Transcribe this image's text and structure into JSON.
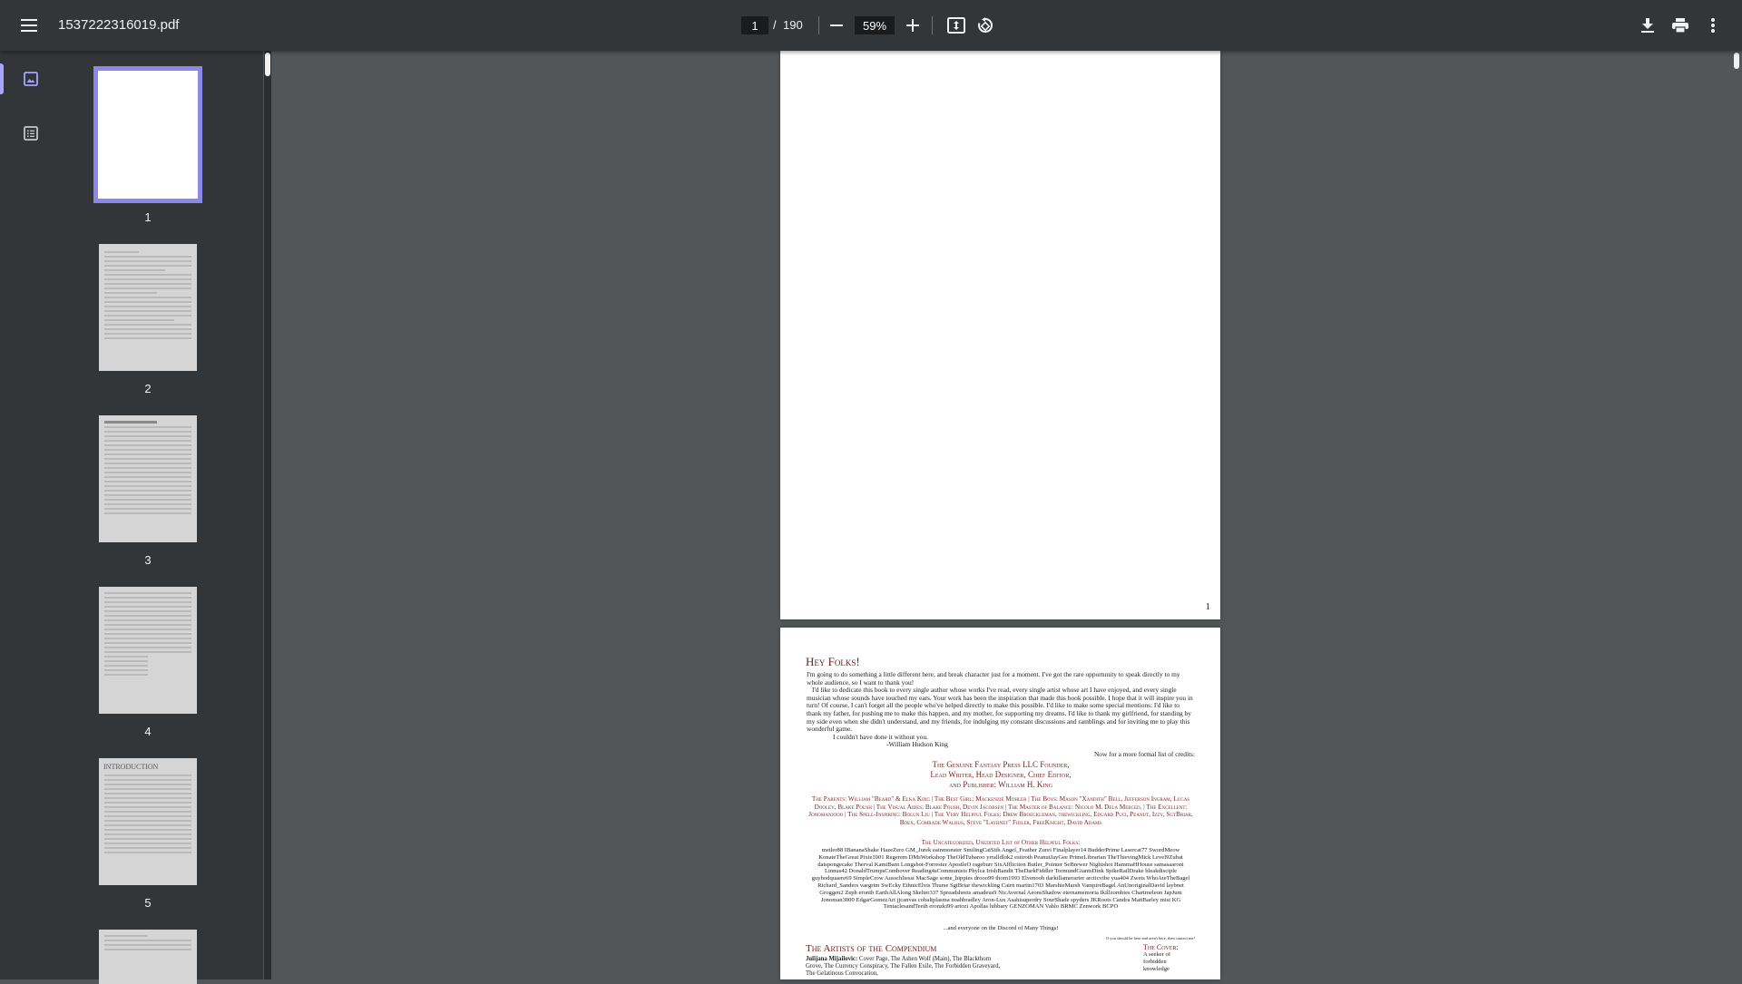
{
  "toolbar": {
    "filename": "1537222316019.pdf",
    "page_current": "1",
    "page_sep": "/",
    "page_total": "190",
    "zoom": "59%",
    "icons": [
      "menu-icon",
      "zoom-out-icon",
      "zoom-in-icon",
      "fit-page-icon",
      "rotate-icon",
      "download-icon",
      "print-icon",
      "more-vert-icon"
    ]
  },
  "sidebar": {
    "icons": [
      "thumbnail-view-icon",
      "outline-view-icon"
    ],
    "thumbs": [
      {
        "label": "1"
      },
      {
        "label": "2"
      },
      {
        "label": "3"
      },
      {
        "label": "4"
      },
      {
        "label": "5",
        "heading": "INTRODUCTION"
      }
    ]
  },
  "page1": {
    "number": "1"
  },
  "page2": {
    "heading": "Hey Folks!",
    "intro_p1": "I'm going to do something a little different here, and break character just for a moment. I've got the rare opportunity to speak directly to my whole audience, so I want to thank you!",
    "intro_p2": "I'd like to dedicate this book to every single author whose works I've read, every single artist whose art I have enjoyed, and every single musician whose sounds have touched my ears. Your work has been the inspiration that made this book possible. I hope that it will inspire you in turn! Of course, I can't forget all the people who've helped directly to make this possible. I'd like to make some special mentions: I'd like to thank my father, for pushing me to make this happen, and my mother, for supporting my dreams. I'd like to thank my girlfriend, for standing by my side even when she didn't understand, and my friends, for indulging my constant discussions and ramblings and for inviting me to play this wonderful game.",
    "intro_p3": "I couldn't have done it without you.",
    "signature": "-William Hudson King",
    "credits_intro": "Now for a more formal list of credits:",
    "credit_head_1": "The Genuine Fantasy Press LLC Founder,",
    "credit_head_2": "Lead Writer, Head Designer, Chief Editor,",
    "credit_head_3": "and Publisher: William H. King",
    "credits_people": "The Parents: William \"Beard\" & Elka King | The Best Girl: Mackenzie Mohler | The Boys: Mason \"Xandith\" Bell, Jefferson Ingram, Lucas Dooley, Blake Poush | The Visual Aides: Blake Poush, Devin Jacobsen | The Master of Balance: Nicolo M. Dela Merced. | The Excellent: Jonomanjooo | The Spell-Inspiring: Bolun Liu | The Very Helpful Folks: Drew Broeckleman, thewickling, Eduard Puci, Peanut, Izzy, SgtBriar, Boex, Comrade Walrus, Steve \"Layhnet\" Fidler, FreeKnight, David Adams",
    "uncategorized_head": "The Uncategorized, Unedited List of Other Helpful Folks:",
    "uncategorized_list": "metler88 IBananaShake HazeZero GM_Jurek eainmonster SmilingCatSith Angel_Feather Zurei Finalplayer14 BudderPrime Lasercat77 SwordMeow KonateTheGreat Pixie1001 Regerem DMsWorkshop TheOldTubaroo yrralldlok2 estiroth PeanutJayGee PrimeLibrarian TheThievingMick Level9Zubat datspongecake Therval KamiBarn Longshot-Forrester ApostleO rageburr SixAffliction Butler_Pointer SeBrewer Nightshot HammaHHouse samasaaroni Linnus42 DonaldTrumpsCombover Reading4sCommunists Phylca IrishBandit TheDarkFiddler TormundGiantsDink SpikeRailDrake bleakdisciple guybodquaere69 SimpleCrow Ausschliessi MacSage some_hippies drooo99 thorn1993 Elvenoob darkillamerarter arcticvibe yua404 Zwets WhoAteTheBagel Richard_Sanders vaegrim SwEcky EthnicElvis Thurse SgtBriar thewickling Cairn martin1703 MarshieMarsh VampireBagel AnUnoriginalDavid laybnet Groggen2 Zeph eronth EarthAllAlong Skelter337 Spreadsheets amadeus9 NicAvernal AeonsShadow eternamemoria Ikillzombies Chartmeleon JapJum Jonoman3000 EdgarGomezArt jjcanvas cobaltplasma noahbradley Aron-Lux Asahisuperdry SourShade spyders JKRoots Candra MattBarley mist KG TentaclesandTeeth eronzki99 artozi Apollas hibbary GENZOMAN Vablo BRMC Zenwork BCPO",
    "everyone": "...and everyone on the Discord of Many Things!",
    "footnote": "If you should be here and aren't here, then contact me!",
    "artists_heading": "The Artists of the Compendium",
    "artist_name": "Julijana Mijailovic:",
    "artist_works": "Cover Page, The Ashen Wolf (Main), The Blackthorn Grove, The Currency Conspiracy, The Fallen Exile, The Forbidden Graveyard, The Gelatinous Convocation,",
    "cover_heading": "The Cover:",
    "cover_text": "A seeker of forbidden knowledge"
  }
}
